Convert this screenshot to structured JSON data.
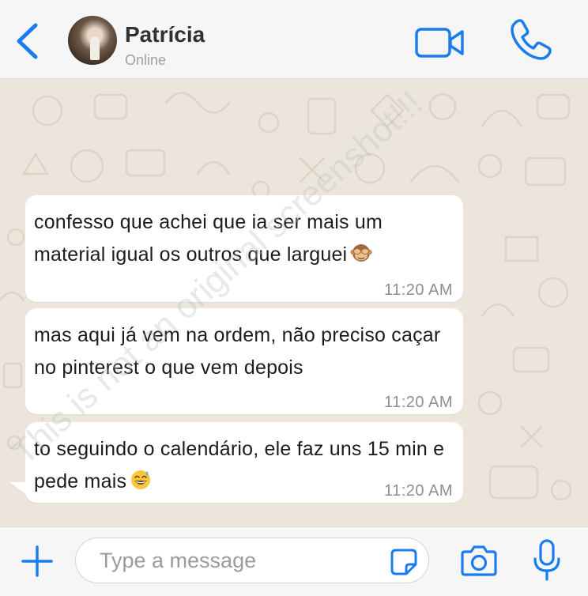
{
  "colors": {
    "accent": "#1a7cf0",
    "header_bg": "#f6f6f6",
    "chat_bg": "#ece5dc",
    "bubble_bg": "#ffffff",
    "text": "#1c1c1c",
    "meta_text": "#8e8e8e"
  },
  "header": {
    "back_icon": "chevron-left",
    "contact_name": "Patrícia",
    "contact_status": "Online",
    "video_icon": "video-camera",
    "phone_icon": "phone"
  },
  "messages": [
    {
      "text": "confesso que achei que ia ser mais um material igual os outros que larguei",
      "emoji": "see-no-evil-monkey",
      "time": "11:20 AM"
    },
    {
      "text": "mas aqui já vem na ordem, não preciso caçar no pinterest o que vem depois",
      "time": "11:20 AM"
    },
    {
      "text": "to seguindo o calendário, ele faz uns 15 min e pede mais",
      "emoji": "grinning-sweat",
      "time": "11:20 AM"
    }
  ],
  "watermark": "This is not an original screenshot!!!",
  "input_bar": {
    "plus_icon": "plus",
    "placeholder": "Type a message",
    "value": "",
    "sticker_icon": "sticker",
    "camera_icon": "camera",
    "mic_icon": "microphone"
  }
}
